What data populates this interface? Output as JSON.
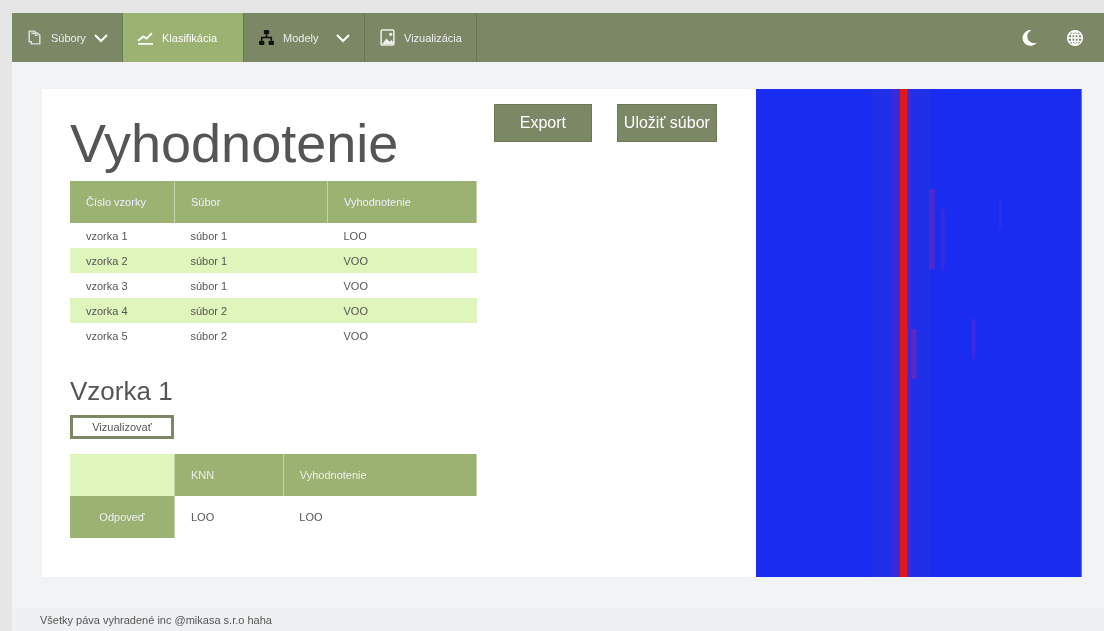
{
  "nav": {
    "items": [
      {
        "label": "Súbory",
        "dropdown": true,
        "selected": false
      },
      {
        "label": "Klasifikácia",
        "dropdown": false,
        "selected": true
      },
      {
        "label": "Modely",
        "dropdown": true,
        "selected": false
      },
      {
        "label": "Vizualizácia",
        "dropdown": false,
        "selected": false
      }
    ]
  },
  "title": "Vyhodnotenie",
  "actions": [
    "Export",
    "Uložiť súbor"
  ],
  "table": {
    "columns": [
      "Číslo vzorky",
      "Súbor",
      "Vyhodnotenie"
    ],
    "rows": [
      [
        "vzorka 1",
        "súbor 1",
        "LOO"
      ],
      [
        "vzorka 2",
        "súbor 1",
        "VOO"
      ],
      [
        "vzorka 3",
        "súbor 1",
        "VOO"
      ],
      [
        "vzorka 4",
        "súbor 2",
        "VOO"
      ],
      [
        "vzorka 5",
        "súbor 2",
        "VOO"
      ]
    ]
  },
  "sample": {
    "title": "Vzorka 1",
    "button": "Vizualizovať",
    "columns": [
      "KNN",
      "Vyhodnotenie"
    ],
    "row_label": "Odpoveď",
    "values": [
      "LOO",
      "LOO"
    ]
  },
  "visual": {
    "kind": "picture"
  },
  "footer": "Všetky páva vyhradené inc @mikasa s.r.o haha"
}
